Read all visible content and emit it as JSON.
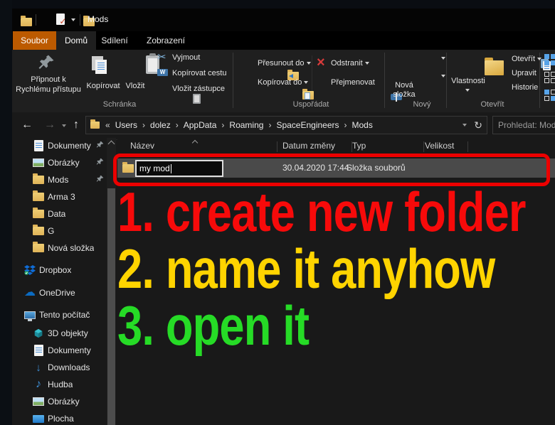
{
  "titlebar": {
    "title": "Mods"
  },
  "tabs": {
    "file": "Soubor",
    "home": "Domů",
    "share": "Sdílení",
    "view": "Zobrazení"
  },
  "ribbon": {
    "pin_line1": "Připnout k",
    "pin_line2": "Rychlému přístupu",
    "copy": "Kopírovat",
    "paste": "Vložit",
    "cut": "Vyjmout",
    "copy_path": "Kopírovat cestu",
    "paste_shortcut": "Vložit zástupce",
    "move_to": "Přesunout do",
    "copy_to": "Kopírovat do",
    "delete": "Odstranit",
    "rename": "Přejmenovat",
    "new_folder_line1": "Nová",
    "new_folder_line2": "složka",
    "properties": "Vlastnosti",
    "open": "Otevřít",
    "edit": "Upravit",
    "history": "Historie",
    "groups": {
      "clipboard": "Schránka",
      "organize": "Uspořádat",
      "new": "Nový",
      "open": "Otevřít"
    }
  },
  "addressbar": {
    "breadcrumb": [
      "Users",
      "dolez",
      "AppData",
      "Roaming",
      "SpaceEngineers",
      "Mods"
    ],
    "search": "Prohledat: Mods"
  },
  "table": {
    "columns": {
      "name": "Název",
      "date": "Datum změny",
      "type": "Typ",
      "size": "Velikost"
    },
    "row": {
      "name": "my mod",
      "date": "30.04.2020 17:44",
      "type": "Složka souborů"
    }
  },
  "sidebar": {
    "items": [
      {
        "label": "Dokumenty"
      },
      {
        "label": "Obrázky"
      },
      {
        "label": "Mods"
      },
      {
        "label": "Arma 3"
      },
      {
        "label": "Data"
      },
      {
        "label": "G"
      },
      {
        "label": "Nová složka"
      },
      {
        "label": "Dropbox"
      },
      {
        "label": "OneDrive"
      },
      {
        "label": "Tento počítač"
      },
      {
        "label": "3D objekty"
      },
      {
        "label": "Dokumenty"
      },
      {
        "label": "Downloads"
      },
      {
        "label": "Hudba"
      },
      {
        "label": "Obrázky"
      },
      {
        "label": "Plocha"
      }
    ]
  },
  "overlay": {
    "lines": [
      {
        "text": "1. create new folder",
        "color": "#f70a0a"
      },
      {
        "text": "2. name it anyhow",
        "color": "#ffd400"
      },
      {
        "text": "3. open it",
        "color": "#26db26"
      }
    ]
  },
  "icons": {
    "scissors": "✂",
    "delete_x": "×",
    "check": "✓",
    "cloud": "☁",
    "down_arrow": "↓",
    "music_note": "♪",
    "refresh": "↻",
    "back_arrow": "←",
    "forward_arrow": "→",
    "up_arrow": "↑",
    "overflow_chevrons": "«",
    "crumb_chevron": "›",
    "w_label": "W"
  },
  "colors": {
    "tab_accent": "#bc5a00",
    "selection": "#4a4a4a",
    "annotation": "#ec0000",
    "folder": "#e0b458"
  }
}
